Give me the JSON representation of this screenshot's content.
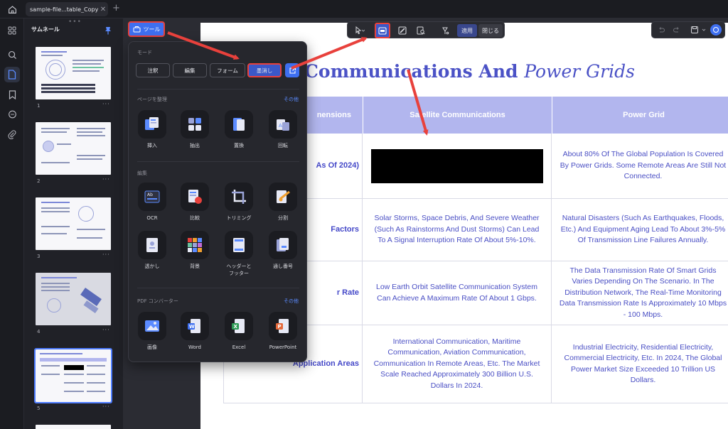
{
  "colors": {
    "accent": "#3e6ff0",
    "highlight_border": "#e8413c",
    "table_header": "#b2b6ee",
    "doc_text": "#4a4fc4",
    "annotation_arrow": "#e8413c"
  },
  "tab": {
    "title": "sample-file...table_Copy1",
    "close": "✕",
    "add": "+"
  },
  "thumbnails": {
    "title": "サムネール",
    "more": "···",
    "pages": [
      "1",
      "2",
      "3",
      "4",
      "5"
    ]
  },
  "tools_button": {
    "label": "ツール",
    "icon": "toolbox-icon"
  },
  "doc_toolbar": {
    "apply": "適用",
    "close": "閉じる"
  },
  "popup": {
    "mode": {
      "label": "モード",
      "buttons": [
        "注釈",
        "編集",
        "フォーム",
        "墨消し"
      ],
      "selected": "墨消し"
    },
    "organize": {
      "label": "ページを整理",
      "more": "その他",
      "items": [
        {
          "label": "挿入",
          "icon": "insert-page-icon"
        },
        {
          "label": "抽出",
          "icon": "extract-page-icon"
        },
        {
          "label": "置換",
          "icon": "replace-page-icon"
        },
        {
          "label": "回転",
          "icon": "rotate-page-icon"
        }
      ]
    },
    "edit": {
      "label": "編集",
      "items": [
        {
          "label": "OCR",
          "icon": "ocr-icon"
        },
        {
          "label": "比較",
          "icon": "compare-icon"
        },
        {
          "label": "トリミング",
          "icon": "crop-icon"
        },
        {
          "label": "分割",
          "icon": "split-icon"
        },
        {
          "label": "透かし",
          "icon": "watermark-icon"
        },
        {
          "label": "背景",
          "icon": "background-icon"
        },
        {
          "label": "ヘッダーと",
          "label2": "フッター",
          "icon": "header-footer-icon"
        },
        {
          "label": "通し番号",
          "icon": "bates-number-icon"
        }
      ]
    },
    "converter": {
      "label": "PDF コンバーター",
      "more": "その他",
      "items": [
        {
          "label": "画像",
          "icon": "image-convert-icon"
        },
        {
          "label": "Word",
          "icon": "word-convert-icon"
        },
        {
          "label": "Excel",
          "icon": "excel-convert-icon"
        },
        {
          "label": "PowerPoint",
          "icon": "powerpoint-convert-icon"
        }
      ]
    }
  },
  "document": {
    "title_bold": "Communications And",
    "title_italic": "Power Grids",
    "headers": [
      "nensions",
      "Satellite Communications",
      "Power Grid"
    ],
    "rows": [
      {
        "label": "As Of 2024)",
        "satellite": "",
        "power": "About 80% Of The Global Population Is Covered By Power Grids. Some Remote Areas Are Still Not Connected."
      },
      {
        "label": "Factors",
        "satellite": "Solar Storms, Space Debris, And Severe Weather (Such As Rainstorms And Dust Storms) Can Lead To A Signal Interruption Rate Of About 5%-10%.",
        "power": "Natural Disasters (Such As Earthquakes, Floods, Etc.) And Equipment Aging Lead To About 3%-5% Of Transmission Line Failures Annually."
      },
      {
        "label": "r Rate",
        "satellite": "Low Earth Orbit Satellite Communication System Can Achieve A Maximum Rate Of About 1 Gbps.",
        "power": "The Data Transmission Rate Of Smart Grids Varies Depending On The Scenario. In The Distribution Network, The Real-Time Monitoring Data Transmission Rate Is Approximately 10 Mbps - 100 Mbps."
      },
      {
        "label": "Application Areas",
        "satellite": "International Communication, Maritime Communication, Aviation Communication, Communication In Remote Areas, Etc. The Market Scale Reached Approximately 300 Billion U.S. Dollars In 2024.",
        "power": "Industrial Electricity, Residential Electricity, Commercial Electricity, Etc. In 2024, The Global Power Market Size Exceeded 10 Trillion US Dollars."
      }
    ]
  }
}
